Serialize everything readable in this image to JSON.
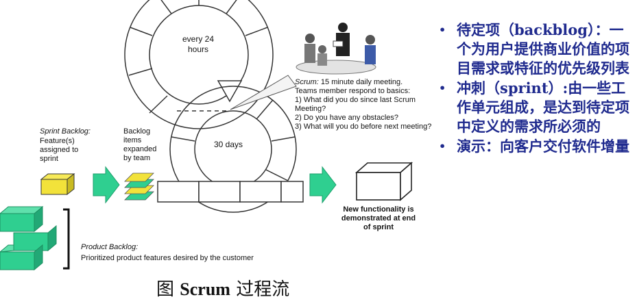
{
  "diagram": {
    "cycle_daily": "every 24 hours",
    "cycle_sprint": "30 days",
    "scrum_title": "Scrum:",
    "scrum_lines": [
      "15 minute daily meeting.",
      "Teams member respond to basics:",
      "1) What did you do since last Scrum Meeting?",
      "2) Do you have any obstacles?",
      "3) What will you do before next meeting?"
    ],
    "sprint_backlog_title": "Sprint Backlog:",
    "sprint_backlog_desc": "Feature(s) assigned to sprint",
    "backlog_items": "Backlog items expanded by team",
    "product_backlog_title": "Product Backlog:",
    "product_backlog_desc": "Prioritized product features desired by the customer",
    "new_functionality": "New functionality is demonstrated at end of sprint",
    "colors": {
      "green": "#2fcf90",
      "yellow": "#f2e23a",
      "accent": "#1f2a8e"
    }
  },
  "caption": {
    "prefix": "图",
    "latin": "Scrum",
    "suffix": "过程流"
  },
  "bullets": [
    "待定项（backblog）：一个为用户提供商业价值的项目需求或特征的优先级列表",
    "冲刺（sprint）:由一些工作单元组成，是达到待定项中定义的需求所必须的",
    "演示：向客户交付软件增量"
  ]
}
